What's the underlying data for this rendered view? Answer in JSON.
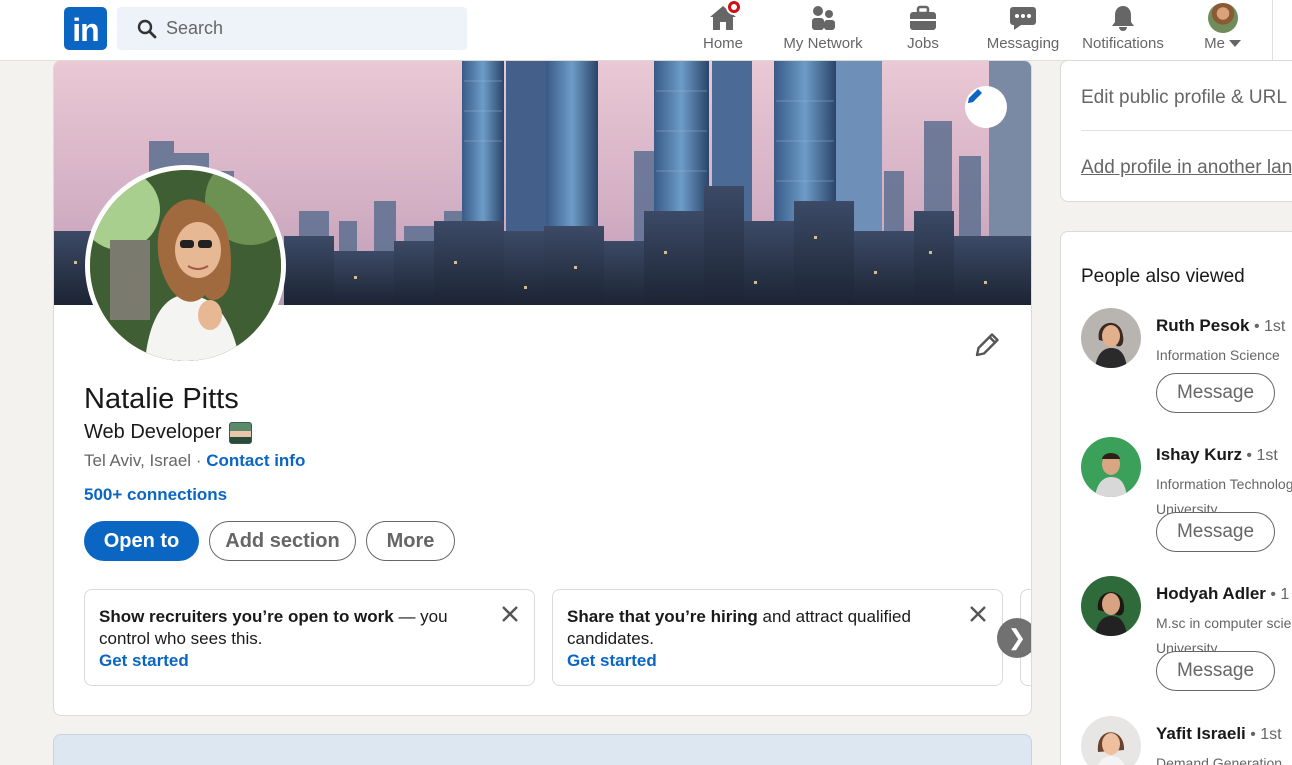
{
  "nav": {
    "logo": "in",
    "search_placeholder": "Search",
    "items": [
      {
        "label": "Home",
        "icon": "home-icon"
      },
      {
        "label": "My Network",
        "icon": "network-icon"
      },
      {
        "label": "Jobs",
        "icon": "briefcase-icon"
      },
      {
        "label": "Messaging",
        "icon": "messaging-icon"
      },
      {
        "label": "Notifications",
        "icon": "bell-icon"
      },
      {
        "label": "Me",
        "icon": "avatar"
      }
    ]
  },
  "profile": {
    "name": "Natalie Pitts",
    "headline": "Web Developer",
    "location": "Tel Aviv, Israel",
    "location_sep": " · ",
    "contact_info": "Contact info",
    "connections": "500+ connections",
    "buttons": {
      "open_to": "Open to",
      "add_section": "Add section",
      "more": "More"
    }
  },
  "promos": [
    {
      "bold": "Show recruiters you’re open to work",
      "rest": " — you control who sees this.",
      "cta": "Get started"
    },
    {
      "bold": "Share that you’re hiring",
      "rest": " and attract qualified candidates.",
      "cta": "Get started"
    }
  ],
  "rail": {
    "edit_public_profile": "Edit public profile & URL",
    "add_profile_language": "Add profile in another language",
    "people_title": "People also viewed",
    "people": [
      {
        "name": "Ruth Pesok",
        "degree": "1st",
        "desc1": "Information Science",
        "desc2": "",
        "action": "Message"
      },
      {
        "name": "Ishay Kurz",
        "degree": "1st",
        "desc1": "Information Technology",
        "desc2": "University",
        "action": "Message"
      },
      {
        "name": "Hodyah Adler",
        "degree": "1",
        "desc1": "M.sc in computer science",
        "desc2": "University",
        "action": "Message"
      },
      {
        "name": "Yafit Israeli",
        "degree": "1st",
        "desc1": "Demand Generation",
        "desc2": "",
        "action": "Message"
      }
    ]
  },
  "colors": {
    "brand": "#0a66c2",
    "notification": "#cc1016"
  }
}
